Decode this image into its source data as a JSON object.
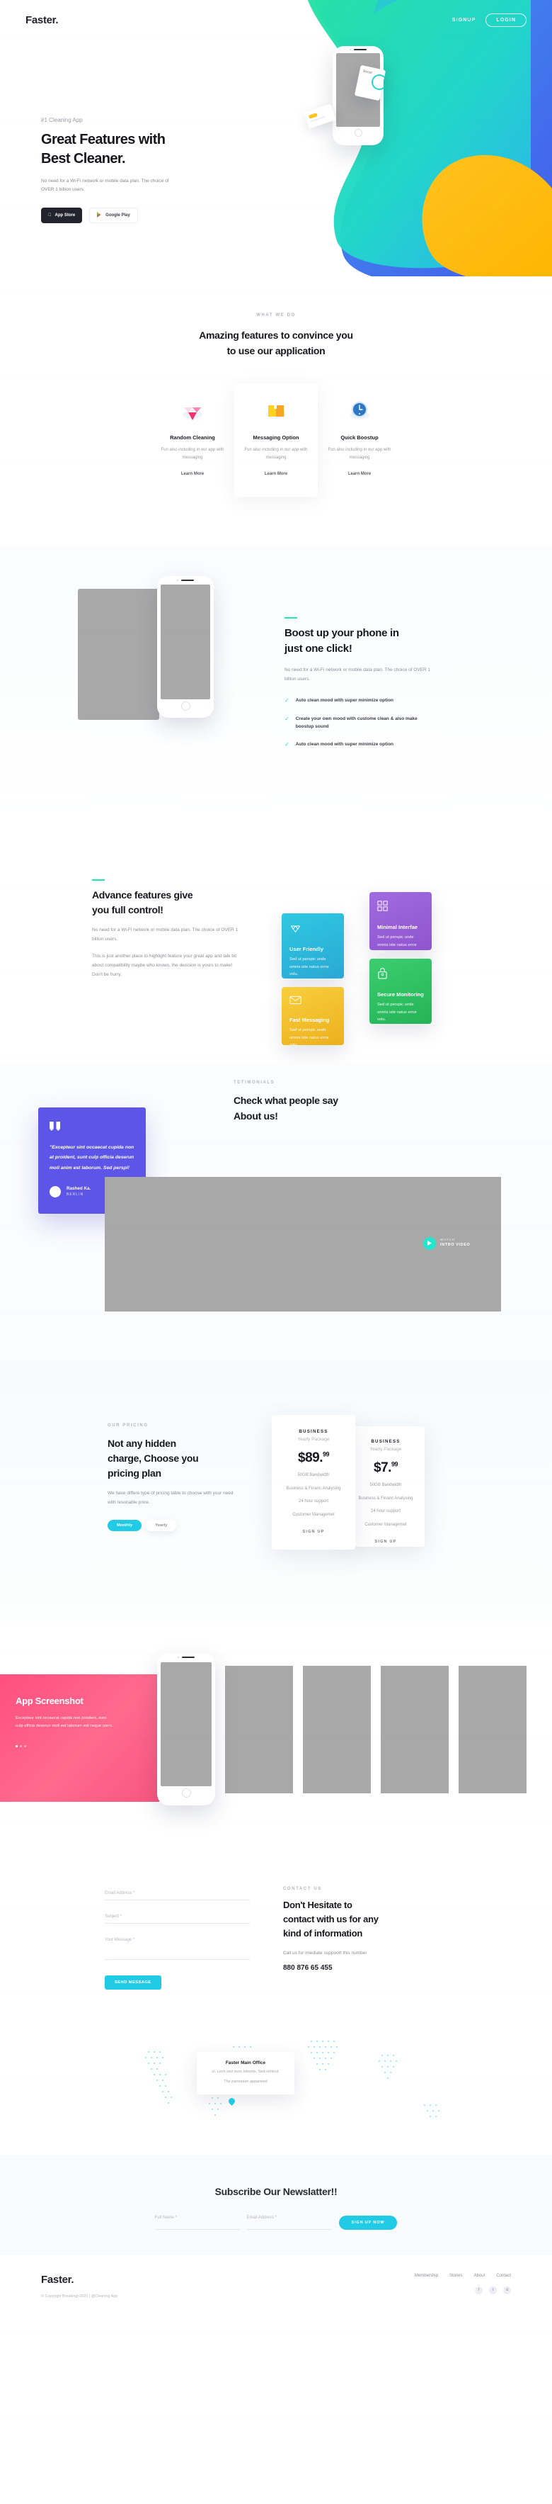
{
  "brand": {
    "name": "Faster.",
    "accent_teal": "#21e6b5",
    "accent_cyan": "#21cbe6",
    "accent_purple": "#5d55e8",
    "accent_pink": "#ff4f7e"
  },
  "header": {
    "logo": "Faster.",
    "signup": "SIGNUP",
    "login": "LOGIN"
  },
  "hero": {
    "eyebrow": "#1 Cleaning App",
    "title_line1": "Great Features with",
    "title_line2": "Best Cleaner.",
    "paragraph": "No need for a  Wi-Fi network or mobile data plan. The choice of OVER 1 billion users.",
    "appstore": "App Store",
    "googleplay": "Google Play",
    "badge_text": "Boost"
  },
  "features": {
    "label": "WHAT WE DO",
    "title_line1": "Amazing features to convince you",
    "title_line2": "to use our application",
    "learn_more": "Learn More",
    "items": [
      {
        "icon": "diamond-icon",
        "title": "Random Cleaning",
        "desc": "Fun also including in our app with messaging"
      },
      {
        "icon": "box-icon",
        "title": "Messaging Option",
        "desc": "Fun also including in our app with messaging"
      },
      {
        "icon": "clock-icon",
        "title": "Quick Boostup",
        "desc": "Fun also including in our app with messaging"
      }
    ]
  },
  "boost": {
    "title_line1": "Boost up your phone in",
    "title_line2": "just one click!",
    "paragraph": "No need for a  Wi-Fi network or mobile data plan. The choice of OVER 1 billion users.",
    "checks": [
      "Auto clean mood with super minimize option",
      "Create your own mood with custome clean & also make boostup sound",
      "Auto clean mood with super minimize option"
    ]
  },
  "advance": {
    "title_line1": "Advance features give",
    "title_line2": "you full control!",
    "paragraph1": "No need for a Wi-Fi network or mobile data plan. The choice of OVER 1 billion users.",
    "paragraph2": "This is just another place to highlight feature your great app and talk bit about compatibility maybe who knows, the decision is yours to make! Don't be hurry.",
    "cards": [
      {
        "icon": "diamond-outline-icon",
        "title": "User Friendly",
        "desc": "Sed ut perspic unde omnis iste natus error volu.",
        "color": "#2bbdd8"
      },
      {
        "icon": "grid-icon",
        "title": "Minimal Interfae",
        "desc": "Sed ut perspic unde omnis iste natus error volu.",
        "color": "#9b5fd6"
      },
      {
        "icon": "envelope-icon",
        "title": "Fast Messaging",
        "desc": "Sed ut perspic unde omnis iste natus error volu.",
        "color": "#f5c231"
      },
      {
        "icon": "lock-icon",
        "title": "Secure Monitoring",
        "desc": "Sed ut perspic unde omnis iste natus error volu.",
        "color": "#2fbf63"
      }
    ]
  },
  "testimonials": {
    "label": "TETIMONIALS",
    "title_line1": "Check what people say",
    "title_line2": "About us!",
    "quote": "\"Excepteur sint occaecat cupida non at proident, sunt culp officia deserun moll anim est laborum. Sed perspi!",
    "author": "Rashed Ka.",
    "city": "BERLIN",
    "video_label": "WATCH",
    "video_sub": "INTRO VIDEO"
  },
  "pricing": {
    "label": "OUR PRICING",
    "title_line1": "Not any hidden",
    "title_line2": "charge, Choose you",
    "title_line3": "pricing plan",
    "paragraph": "We have differe type of pricing table to choose with your need with resonable price.",
    "toggle_monthly": "Monthly",
    "toggle_yearly": "Yearly",
    "sign_up": "SIGN UP",
    "plans": [
      {
        "name": "BUSINESS",
        "package": "Yearly Package",
        "currency": "$",
        "amount": "89.",
        "cents": "99",
        "features": [
          "50GB Bandwidth",
          "Business & Financ Analysing",
          "24 hour support",
          "Customer Managemet"
        ]
      },
      {
        "name": "BUSINESS",
        "package": "Yearly Package",
        "currency": "$",
        "amount": "7.",
        "cents": "99",
        "features": [
          "50GB Bandwidth",
          "Business & Financ Analysing",
          "24 hour support",
          "Customer Managemet"
        ]
      }
    ]
  },
  "screenshot": {
    "title": "App Screenshot",
    "paragraph": "Excepteur sint occaecat cupida non proident, sunt culp officia deserun moll est laborum est neque porro."
  },
  "contact": {
    "label": "CONTACT US",
    "title_line1": "Don't Hesitate to",
    "title_line2": "contact with us for any",
    "title_line3": "kind of information",
    "sub": "Call us for imediate suppoort this number",
    "phone": "880 876 65 455",
    "fields": [
      {
        "name": "email-field",
        "placeholder": "Email Address *"
      },
      {
        "name": "subject-field",
        "placeholder": "Subject *"
      },
      {
        "name": "message-field",
        "placeholder": "Your Message *"
      }
    ],
    "send_label": "SEND MESSAGE"
  },
  "map": {
    "card_title": "Faster Main Office",
    "card_line1": "ul. Lech sed nunc lobortis, Sed vehicul.",
    "card_line2": "The parsonian appareted"
  },
  "newsletter": {
    "title": "Subscribe  Our Newslatter!!",
    "field_name": "Full Name *",
    "field_email": "Email Address *",
    "button": "SIGN UP NOW"
  },
  "footer": {
    "logo": "Faster.",
    "nav": [
      "Membership",
      "Stories",
      "About",
      "Contact"
    ],
    "copyright": "© Copyright Breakingt 2020 | @Cleaning App",
    "socials": [
      "facebook-icon",
      "twitter-icon",
      "dribbble-icon"
    ]
  }
}
